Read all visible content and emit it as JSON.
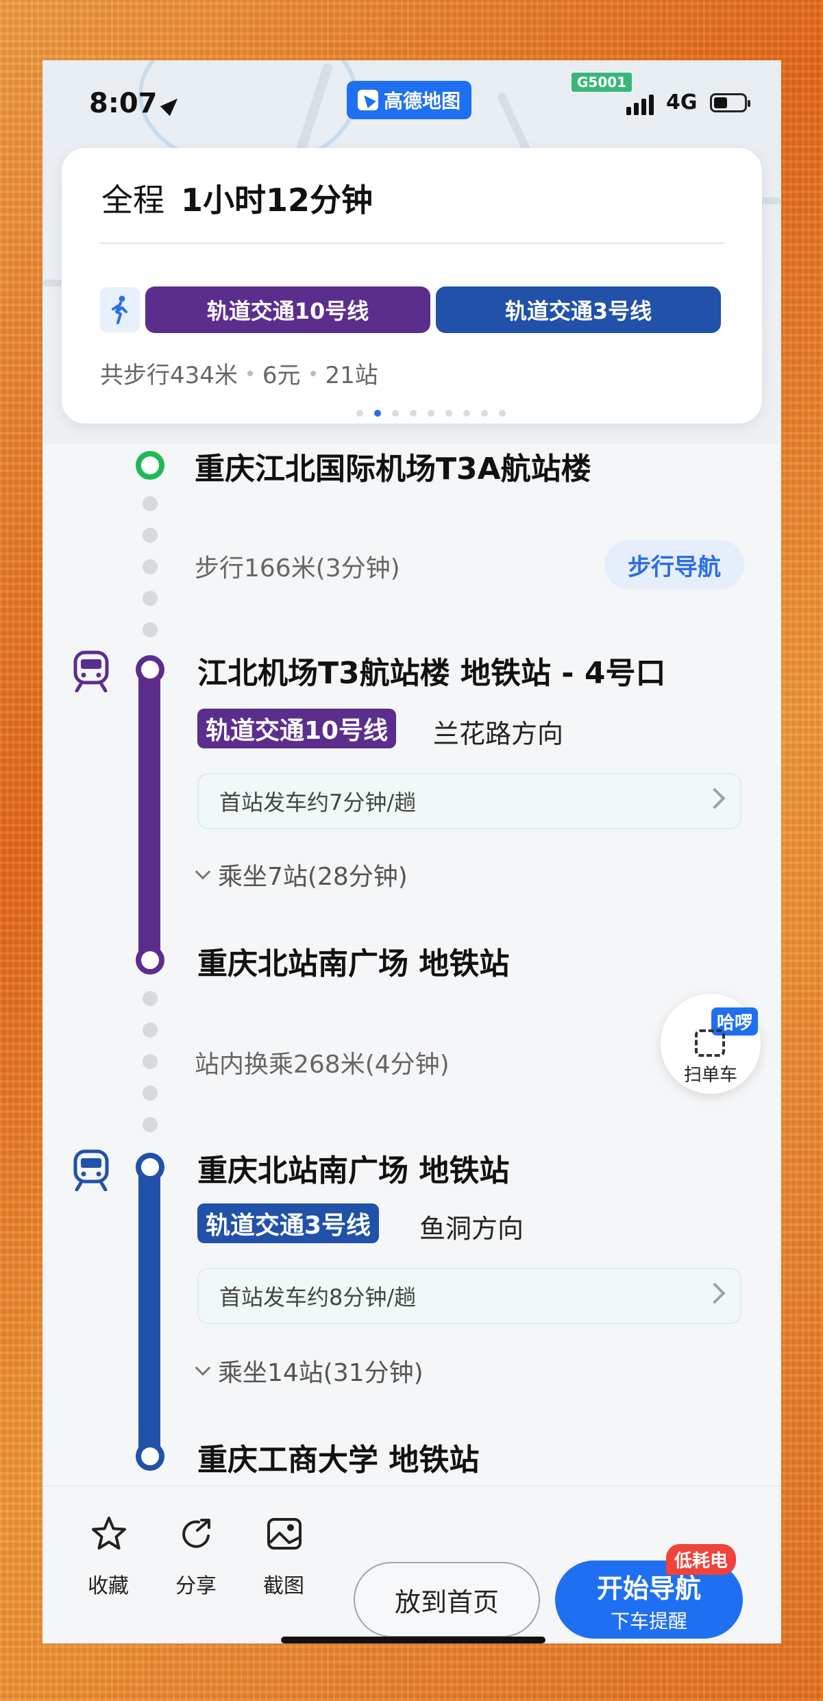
{
  "status": {
    "time": "8:07",
    "app_badge": "高德地图",
    "road_sign": "G5001",
    "network": "4G"
  },
  "summary": {
    "total_label": "全程",
    "total_duration": "1小时12分钟",
    "lines": [
      "轨道交通10号线",
      "轨道交通3号线"
    ],
    "walk_distance": "共步行434米",
    "fare": "6元",
    "stops": "21站",
    "pages": 9,
    "active_page": 1
  },
  "steps": {
    "start": "重庆江北国际机场T3A航站楼",
    "walk1": "步行166米(3分钟)",
    "walk_nav_button": "步行导航",
    "board1_station": "江北机场T3航站楼 地铁站 - 4号口",
    "board1_line": "轨道交通10号线",
    "board1_direction": "兰花路方向",
    "board1_headway": "首站发车约7分钟/趟",
    "board1_ride": "乘坐7站(28分钟)",
    "alight1_station": "重庆北站南广场 地铁站",
    "transfer": "站内换乘268米(4分钟)",
    "board2_station": "重庆北站南广场 地铁站",
    "board2_line": "轨道交通3号线",
    "board2_direction": "鱼洞方向",
    "board2_headway": "首站发车约8分钟/趟",
    "board2_ride": "乘坐14站(31分钟)",
    "alight2_station": "重庆工商大学 地铁站"
  },
  "bike": {
    "tag": "哈啰",
    "label": "扫单车"
  },
  "bottom": {
    "favorite": "收藏",
    "share": "分享",
    "screenshot": "截图",
    "home_button": "放到首页",
    "nav_button": "开始导航",
    "nav_sub": "下车提醒",
    "nav_badge": "低耗电"
  },
  "colors": {
    "line10": "#5b2e8e",
    "line3": "#2151a8",
    "start": "#21b858",
    "accent": "#1f6ff2"
  }
}
